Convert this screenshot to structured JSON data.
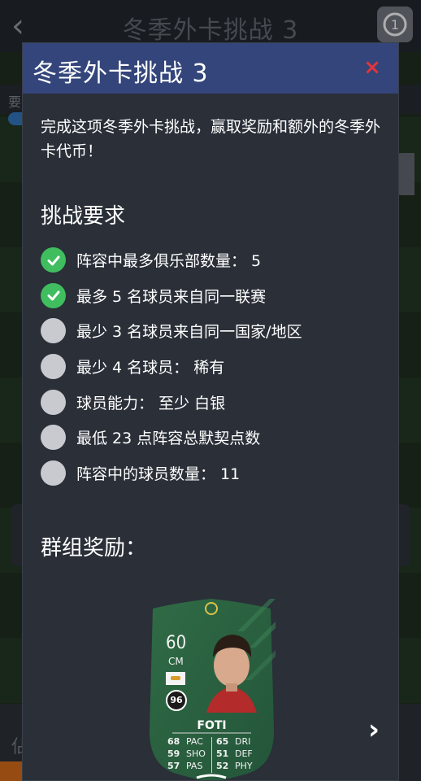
{
  "background": {
    "title": "冬季外卡挑战 3",
    "hint_text": "要",
    "bottom_text": "佔"
  },
  "modal": {
    "title": "冬季外卡挑战 3",
    "close_label": "×",
    "description": "完成这项冬季外卡挑战，赢取奖励和额外的冬季外卡代币！",
    "requirements_title": "挑战要求",
    "requirements": [
      {
        "text": "阵容中最多俱乐部数量： 5",
        "completed": true
      },
      {
        "text": "最多 5 名球员来自同一联赛",
        "completed": true
      },
      {
        "text": "最少 3 名球员来自同一国家/地区",
        "completed": false
      },
      {
        "text": "最少 4 名球员： 稀有",
        "completed": false
      },
      {
        "text": "球员能力： 至少 白银",
        "completed": false
      },
      {
        "text": "最低 23 点阵容总默契点数",
        "completed": false
      },
      {
        "text": "阵容中的球员数量： 11",
        "completed": false
      }
    ],
    "rewards_title": "群组奖励：",
    "reward_card": {
      "rating": "60",
      "position": "CM",
      "club": "96",
      "name": "FOTI",
      "stats_left": [
        {
          "value": "68",
          "label": "PAC"
        },
        {
          "value": "59",
          "label": "SHO"
        },
        {
          "value": "57",
          "label": "PAS"
        }
      ],
      "stats_right": [
        {
          "value": "65",
          "label": "DRI"
        },
        {
          "value": "51",
          "label": "DEF"
        },
        {
          "value": "52",
          "label": "PHY"
        }
      ]
    },
    "next_label": "›"
  },
  "colors": {
    "header": "#33457a",
    "modal_bg": "#2a2f38",
    "check_green": "#3fbd5f",
    "pending_gray": "#c9cad0",
    "close_red": "#e0353d",
    "card_green": "#2e6a44"
  },
  "icons": {
    "back": "back-chevron-icon",
    "refresh": "refresh-counter-icon",
    "check": "check-icon"
  }
}
